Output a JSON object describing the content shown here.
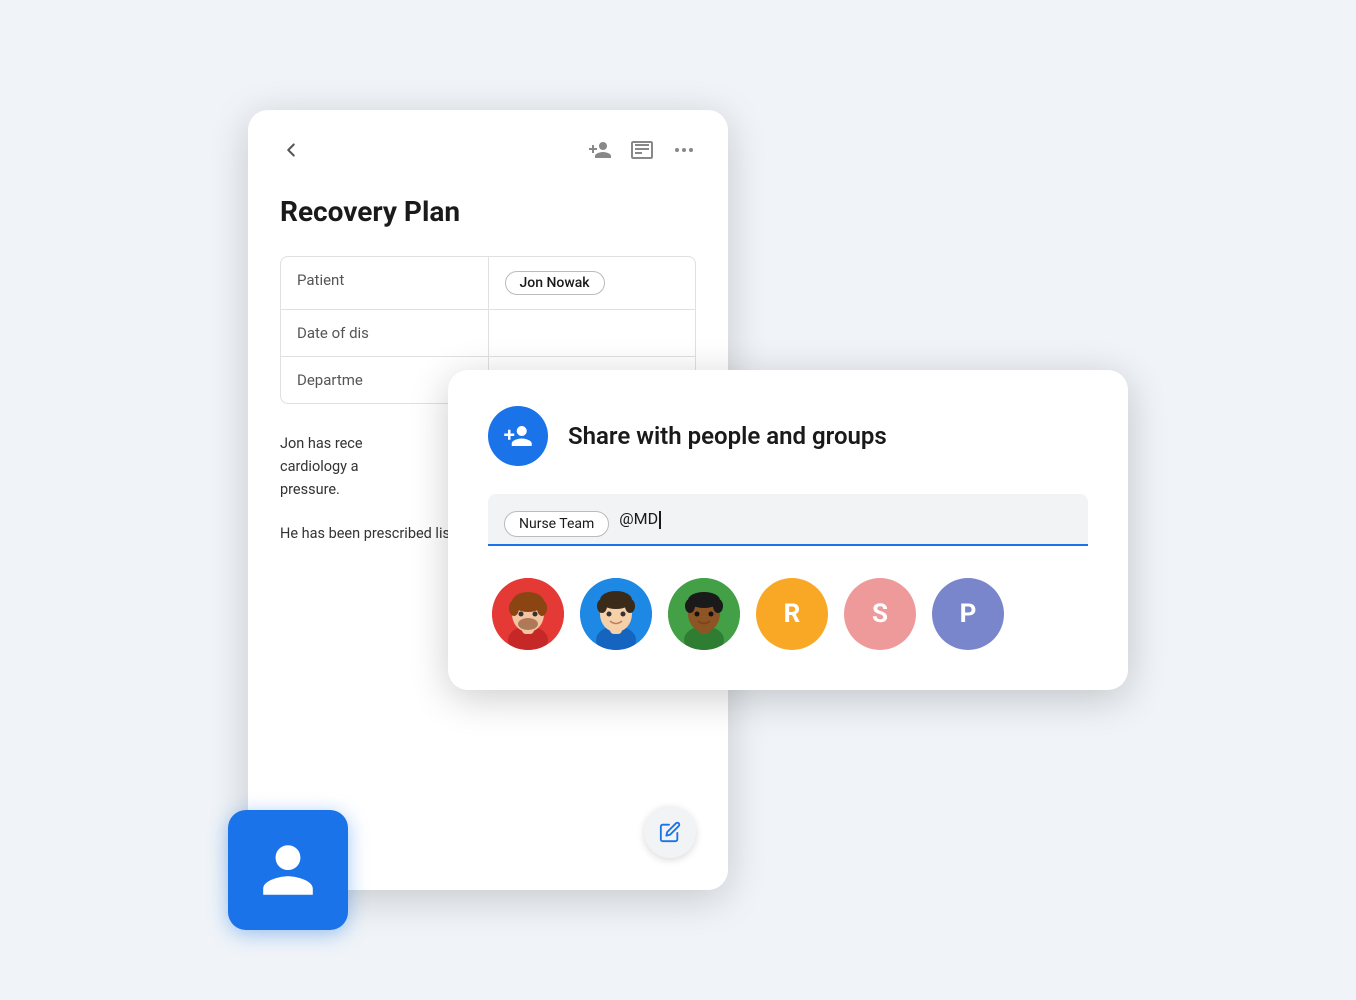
{
  "recovery_card": {
    "title": "Recovery Plan",
    "back_icon": "←",
    "add_person_icon": "person-add",
    "notes_icon": "notes",
    "more_icon": "more-horiz",
    "table": {
      "rows": [
        {
          "label": "Patient",
          "value": "Jon Nowak",
          "is_chip": true
        },
        {
          "label": "Date of dis",
          "value": "",
          "is_chip": false
        },
        {
          "label": "Departme",
          "value": "",
          "is_chip": false
        }
      ]
    },
    "body1": "Jon has rece cardiology a pressure.",
    "body2": "He has been prescribed lisinopril, to be taken daily.",
    "edit_label": "edit"
  },
  "share_card": {
    "title": "Share with people and groups",
    "input": {
      "chip_label": "Nurse Team",
      "typed_text": "@MD"
    },
    "avatars": [
      {
        "type": "photo",
        "color": "#e53935",
        "label": "Person 1",
        "initials": ""
      },
      {
        "type": "photo",
        "color": "#1e88e5",
        "label": "Person 2",
        "initials": ""
      },
      {
        "type": "photo",
        "color": "#43a047",
        "label": "Person 3",
        "initials": ""
      },
      {
        "type": "initial",
        "color": "#f9a825",
        "label": "Person R",
        "initials": "R"
      },
      {
        "type": "initial",
        "color": "#ef9a9a",
        "label": "Person S",
        "initials": "S"
      },
      {
        "type": "initial",
        "color": "#7986cb",
        "label": "Person P",
        "initials": "P"
      }
    ]
  },
  "blue_card": {
    "icon": "person"
  }
}
